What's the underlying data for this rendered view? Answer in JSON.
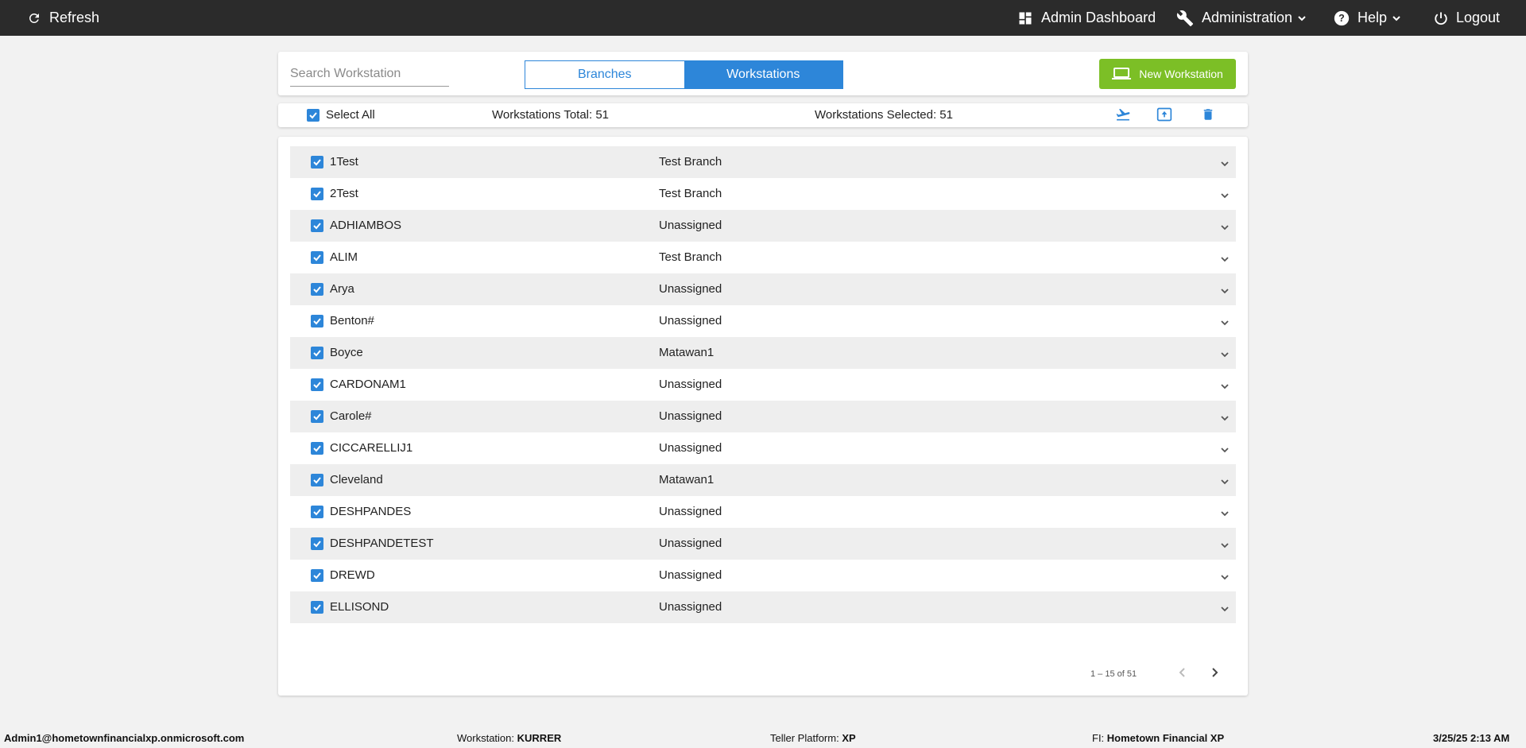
{
  "topbar": {
    "refresh": "Refresh",
    "admin_dashboard": "Admin Dashboard",
    "administration": "Administration",
    "help": "Help",
    "logout": "Logout"
  },
  "header": {
    "search_placeholder": "Search Workstation",
    "tab_branches": "Branches",
    "tab_workstations": "Workstations",
    "active_tab": "Workstations",
    "new_workstation": "New Workstation",
    "new_button_color": "#7cbf26",
    "accent": "#2d86d9"
  },
  "summary": {
    "select_all": "Select All",
    "total": "Workstations Total: 51",
    "selected": "Workstations Selected: 51"
  },
  "rows": [
    {
      "name": "1Test",
      "branch": "Test Branch"
    },
    {
      "name": "2Test",
      "branch": "Test Branch"
    },
    {
      "name": "ADHIAMBOS",
      "branch": "Unassigned"
    },
    {
      "name": "ALIM",
      "branch": "Test Branch"
    },
    {
      "name": "Arya",
      "branch": "Unassigned"
    },
    {
      "name": "Benton#",
      "branch": "Unassigned"
    },
    {
      "name": "Boyce",
      "branch": "Matawan1"
    },
    {
      "name": "CARDONAM1",
      "branch": "Unassigned"
    },
    {
      "name": "Carole#",
      "branch": "Unassigned"
    },
    {
      "name": "CICCARELLIJ1",
      "branch": "Unassigned"
    },
    {
      "name": "Cleveland",
      "branch": "Matawan1"
    },
    {
      "name": "DESHPANDES",
      "branch": "Unassigned"
    },
    {
      "name": "DESHPANDETEST",
      "branch": "Unassigned"
    },
    {
      "name": "DREWD",
      "branch": "Unassigned"
    },
    {
      "name": "ELLISOND",
      "branch": "Unassigned"
    }
  ],
  "pager": {
    "range": "1 – 15 of 51"
  },
  "status": {
    "user": "Admin1@hometownfinancialxp.onmicrosoft.com",
    "workstation_label": "Workstation:",
    "workstation_value": "KURRER",
    "platform_label": "Teller Platform:",
    "platform_value": "XP",
    "fi_label": "FI:",
    "fi_value": "Hometown Financial XP",
    "datetime": "3/25/25 2:13 AM"
  }
}
